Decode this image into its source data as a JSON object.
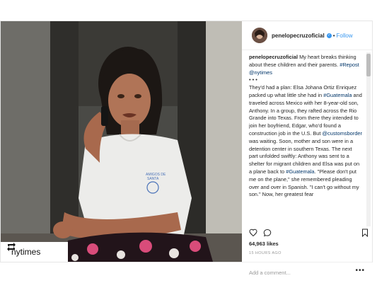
{
  "post": {
    "username": "penelopecruzoficial",
    "separator": "•",
    "follow_label": "Follow",
    "verified_glyph": "✓",
    "caption_user": "penelopecruzoficial",
    "caption_intro": "My heart breaks thinking about these children and their parents.",
    "caption_repost_tag": "#Repost",
    "caption_mention": "@nytimes",
    "caption_dots": "• • •",
    "caption_p1": "They'd had a plan: Elsa Johana Ortiz Enriquez packed up what little she had in",
    "caption_hashtag1": "#Guatemala",
    "caption_p2": "and traveled across Mexico with her 8-year-old son, Anthony. In a group, they rafted across the Rio Grande into Texas. From there they intended to join her boyfriend, Edgar, who'd found a construction job in the U.S. But",
    "caption_mention2": "@customsborder",
    "caption_p3": "was waiting. Soon, mother and son were in a detention center in southern Texas. The next part unfolded swiftly: Anthony was sent to a shelter for migrant children and Elsa was put on a plane back to",
    "caption_hashtag2": "#Guatemala",
    "caption_p4": ". \"Please don't put me on the plane,\" she remembered pleading over and over in Spanish. \"I can't go without my son.\" Now, her greatest fear",
    "likes": "64,963 likes",
    "time_ago": "15 HOURS AGO",
    "comment_placeholder": "Add a comment...",
    "more_glyph": "•••",
    "repost_user": "nytimes"
  },
  "icons": {
    "like": "heart-icon",
    "comment": "comment-icon",
    "save": "bookmark-icon",
    "repost": "repost-icon",
    "verified": "verified-badge-icon"
  },
  "colors": {
    "link": "#3897f0",
    "hashtag": "#003569",
    "muted": "#999999"
  }
}
